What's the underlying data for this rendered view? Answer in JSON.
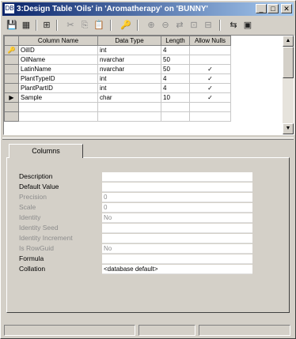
{
  "window": {
    "title": "3:Design Table 'Oils' in 'Aromatherapy' on 'BUNNY'",
    "app_icon": "DB",
    "minimize": "_",
    "maximize": "□",
    "close": "✕"
  },
  "toolbar": {
    "save": "💾",
    "properties": "▦",
    "manage_indexes": "⊞",
    "cut": "✂",
    "copy": "⎘",
    "paste": "📋",
    "primary_key": "🔑",
    "insert_column": "⊕",
    "delete_column": "⊖",
    "manage_relationships": "⇄",
    "manage_constraints": "⊡",
    "generate_script": "⊟",
    "extra_1": "⇆",
    "extra_2": "▣"
  },
  "grid": {
    "columns": [
      "Column Name",
      "Data Type",
      "Length",
      "Allow Nulls"
    ],
    "rows": [
      {
        "marker": "🔑",
        "name": "OilID",
        "type": "int",
        "length": "4",
        "nulls": ""
      },
      {
        "marker": "",
        "name": "OilName",
        "type": "nvarchar",
        "length": "50",
        "nulls": ""
      },
      {
        "marker": "",
        "name": "LatinName",
        "type": "nvarchar",
        "length": "50",
        "nulls": "✓"
      },
      {
        "marker": "",
        "name": "PlantTypeID",
        "type": "int",
        "length": "4",
        "nulls": "✓"
      },
      {
        "marker": "",
        "name": "PlantPartID",
        "type": "int",
        "length": "4",
        "nulls": "✓"
      },
      {
        "marker": "▶",
        "name": "Sample",
        "type": "char",
        "length": "10",
        "nulls": "✓"
      }
    ]
  },
  "tab": {
    "label": "Columns"
  },
  "properties": [
    {
      "label": "Description",
      "value": "",
      "disabled": false
    },
    {
      "label": "Default Value",
      "value": "",
      "disabled": false
    },
    {
      "label": "Precision",
      "value": "0",
      "disabled": true
    },
    {
      "label": "Scale",
      "value": "0",
      "disabled": true
    },
    {
      "label": "Identity",
      "value": "No",
      "disabled": true
    },
    {
      "label": "Identity Seed",
      "value": "",
      "disabled": true
    },
    {
      "label": "Identity Increment",
      "value": "",
      "disabled": true
    },
    {
      "label": "Is RowGuid",
      "value": "No",
      "disabled": true
    },
    {
      "label": "Formula",
      "value": "",
      "disabled": false
    },
    {
      "label": "Collation",
      "value": "<database default>",
      "disabled": false
    }
  ]
}
